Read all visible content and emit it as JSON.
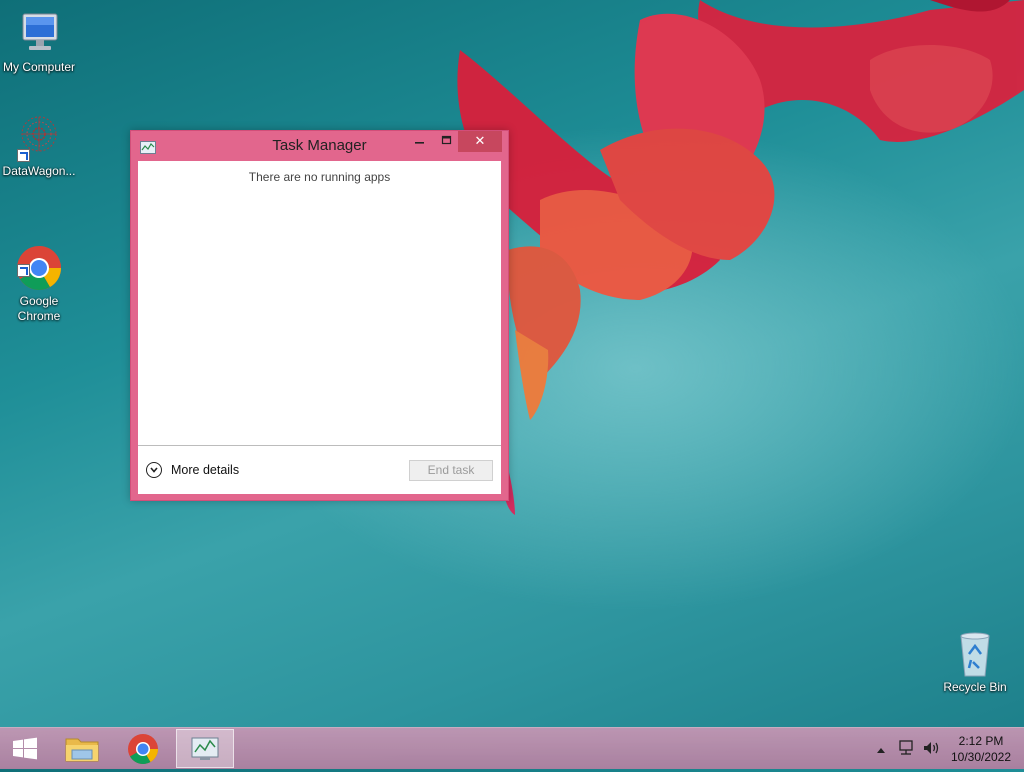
{
  "desktop": {
    "icons": [
      {
        "label": "My Computer"
      },
      {
        "label": "DataWagon..."
      },
      {
        "label": "Google\nChrome"
      },
      {
        "label": "Recycle Bin"
      }
    ]
  },
  "task_manager": {
    "title": "Task Manager",
    "empty_message": "There are no running apps",
    "more_details_label": "More details",
    "end_task_label": "End task",
    "close_glyph": "✕",
    "accent_color": "#e2668d"
  },
  "taskbar": {
    "items": [
      "start-button",
      "file-explorer",
      "google-chrome",
      "task-manager"
    ],
    "clock": {
      "time": "2:12 PM",
      "date": "10/30/2022"
    }
  }
}
